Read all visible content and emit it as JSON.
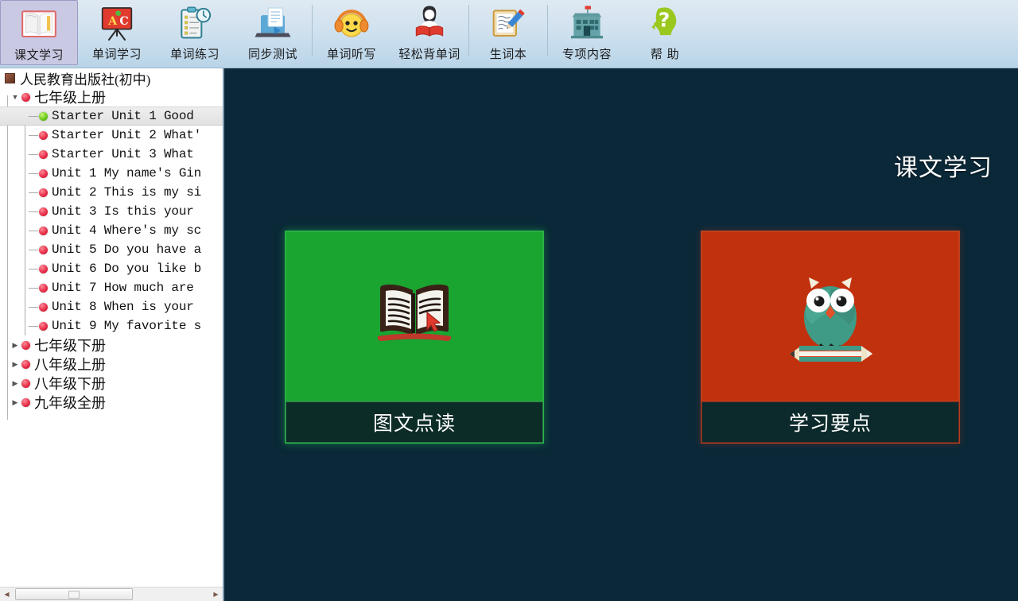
{
  "toolbar": {
    "items": [
      {
        "label": "课文学习",
        "icon": "open-book-icon",
        "selected": true
      },
      {
        "label": "单词学习",
        "icon": "abc-blackboard-icon",
        "selected": false
      },
      {
        "label": "单词练习",
        "icon": "clipboard-clock-icon",
        "selected": false
      },
      {
        "label": "同步测试",
        "icon": "laptop-document-play-icon",
        "selected": false
      },
      {
        "label": "单词听写",
        "icon": "headphones-smiley-icon",
        "selected": false
      },
      {
        "label": "轻松背单词",
        "icon": "girl-reading-book-icon",
        "selected": false
      },
      {
        "label": "生词本",
        "icon": "notebook-pencil-icon",
        "selected": false
      },
      {
        "label": "专项内容",
        "icon": "school-building-icon",
        "selected": false
      },
      {
        "label": "帮 助",
        "icon": "question-head-icon",
        "selected": false
      }
    ]
  },
  "sidebar": {
    "root": {
      "label": "人民教育出版社(初中)",
      "icon": "book-node-icon"
    },
    "grades": [
      {
        "label": "七年级上册",
        "expanded": true
      },
      {
        "label": "七年级下册",
        "expanded": false
      },
      {
        "label": "八年级上册",
        "expanded": false
      },
      {
        "label": "八年级下册",
        "expanded": false
      },
      {
        "label": "九年级全册",
        "expanded": false
      }
    ],
    "units": [
      {
        "label": "Starter Unit 1 Good",
        "selected": true
      },
      {
        "label": "Starter Unit 2 What'",
        "selected": false
      },
      {
        "label": "Starter Unit 3 What",
        "selected": false
      },
      {
        "label": "Unit 1 My name's Gin",
        "selected": false
      },
      {
        "label": "Unit 2 This is my si",
        "selected": false
      },
      {
        "label": "Unit 3 Is this your",
        "selected": false
      },
      {
        "label": "Unit 4 Where's my sc",
        "selected": false
      },
      {
        "label": "Unit 5 Do you have a",
        "selected": false
      },
      {
        "label": "Unit 6 Do you like b",
        "selected": false
      },
      {
        "label": "Unit 7 How much are",
        "selected": false
      },
      {
        "label": "Unit 8 When is your",
        "selected": false
      },
      {
        "label": "Unit 9 My favorite s",
        "selected": false
      }
    ],
    "scrollbar": {
      "left_arrow": "◀",
      "right_arrow": "▶"
    }
  },
  "main": {
    "title": "课文学习",
    "cards": [
      {
        "caption": "图文点读",
        "icon": "open-book-cursor-icon",
        "bg_color": "#1aa430",
        "accent": "#27b74a"
      },
      {
        "caption": "学习要点",
        "icon": "owl-on-pencil-icon",
        "bg_color": "#c2310d",
        "accent": "#b8401f"
      }
    ]
  },
  "colors": {
    "toolbar_top": "#dfe9f2",
    "toolbar_bottom": "#b9d4e7",
    "selected_button": "#c9c9e4",
    "main_background": "#0a2838",
    "caption_background": "#0d2b2b",
    "bullet_red": "#e8304a",
    "bullet_green": "#6fcc1e"
  }
}
